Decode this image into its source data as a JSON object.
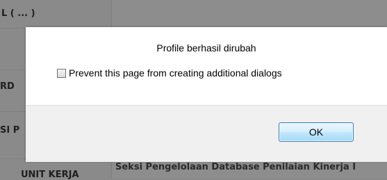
{
  "background": {
    "rows": [
      {
        "label": "L ( ... )",
        "value": ""
      },
      {
        "label": "RD",
        "value": ""
      },
      {
        "label": "SI P",
        "value": ""
      },
      {
        "label": "UNIT KERJA",
        "value": "Seksi Pengelolaan Database Penilaian Kinerja I"
      }
    ]
  },
  "dialog": {
    "message": "Profile berhasil dirubah",
    "checkbox_label": "Prevent this page from creating additional dialogs",
    "checkbox_checked": false,
    "ok_label": "OK"
  },
  "colors": {
    "overlay": "#8a8a8a",
    "dialog_bg": "#ffffff",
    "footer_bg": "#f0f0f0",
    "button_border": "#3c7fb1"
  }
}
